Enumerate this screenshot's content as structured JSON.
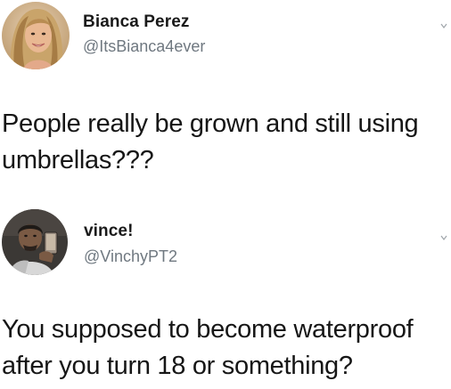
{
  "tweets": [
    {
      "display_name": "Bianca Perez",
      "handle": "@ItsBianca4ever",
      "text": "People really be grown and still using umbrellas???",
      "avatar_icon": "profile-photo-woman",
      "menu_icon": "chevron-down-icon"
    },
    {
      "display_name": "vince!",
      "handle": "@VinchyPT2",
      "text": "You supposed to become waterproof after you turn 18 or something?",
      "avatar_icon": "profile-photo-man",
      "menu_icon": "chevron-down-icon"
    }
  ],
  "colors": {
    "text": "#161616",
    "handle": "#6f7880",
    "background": "#ffffff"
  }
}
